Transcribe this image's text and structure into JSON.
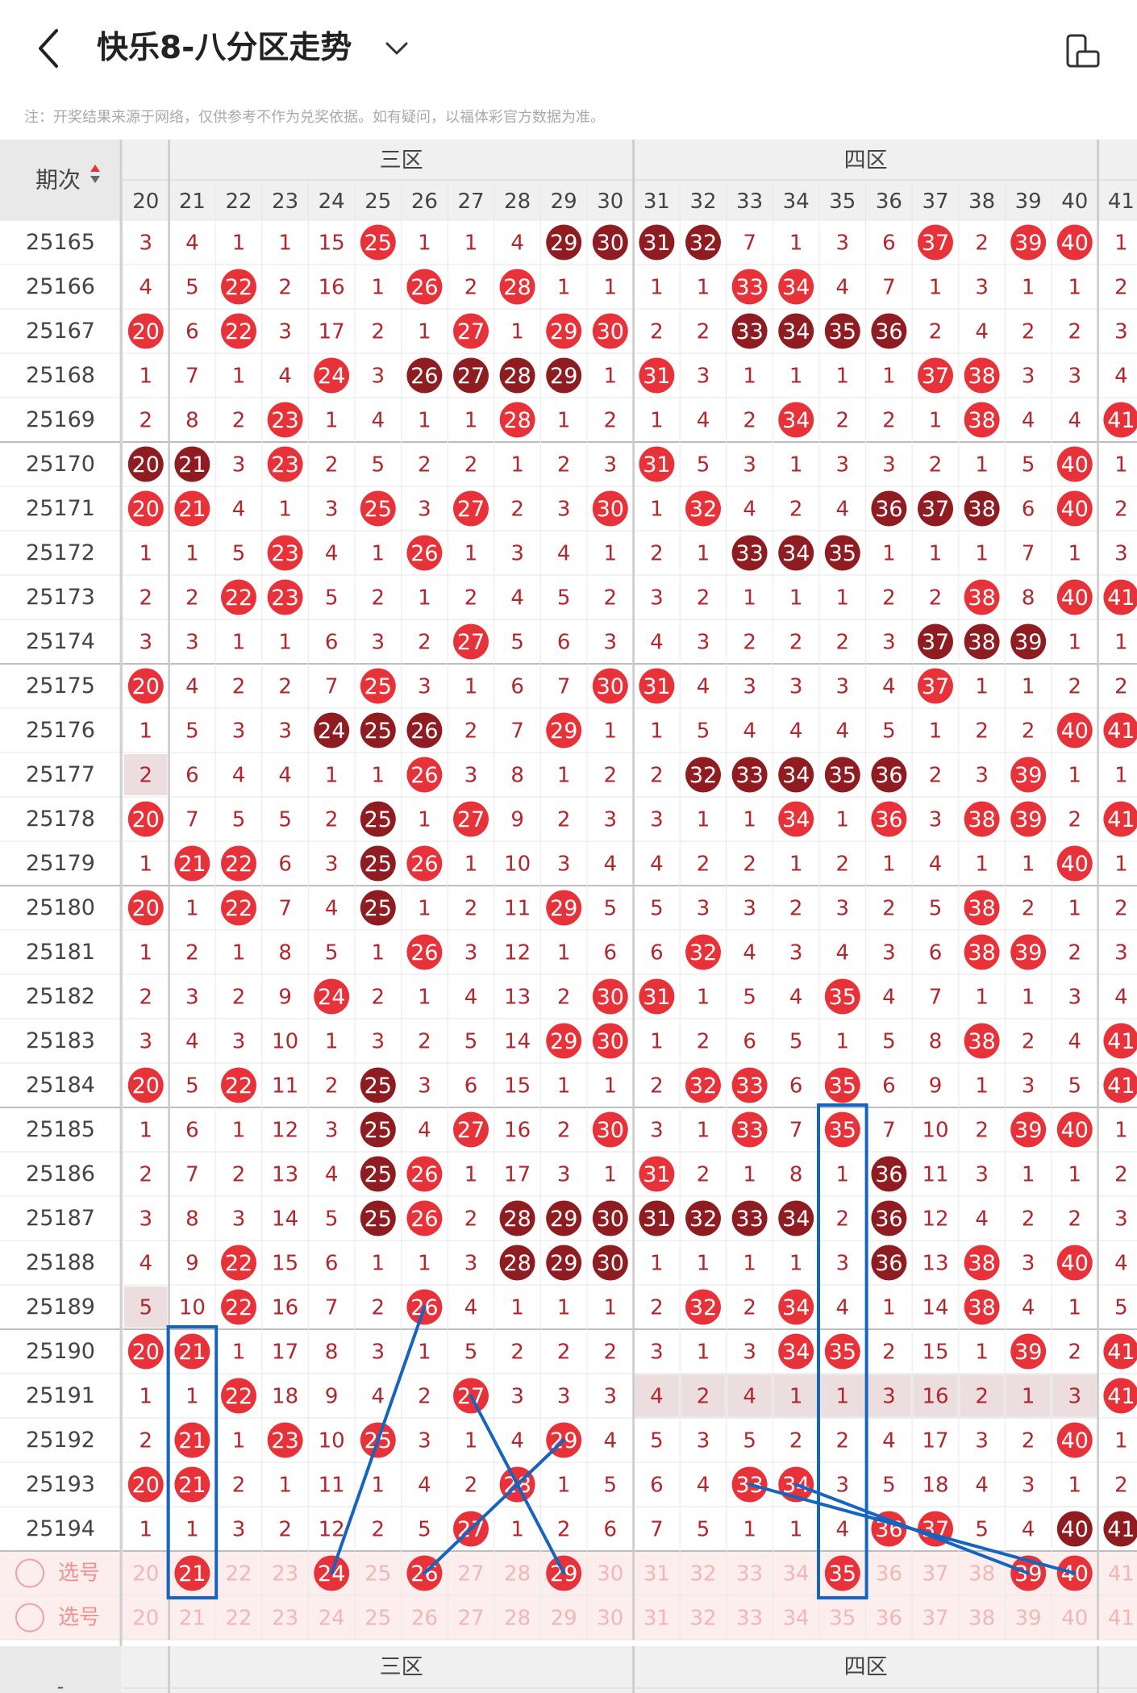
{
  "header": {
    "title": "快乐8-八分区走势",
    "note": "注：开奖结果来源于网络，仅供参考不作为兑奖依据。如有疑问，以福体彩官方数据为准。"
  },
  "table": {
    "period_label": "期次",
    "zones": [
      "三区",
      "四区"
    ],
    "columns": [
      20,
      21,
      22,
      23,
      24,
      25,
      26,
      27,
      28,
      29,
      30,
      31,
      32,
      33,
      34,
      35,
      36,
      37,
      38,
      39,
      40,
      41
    ],
    "select_label": "选号",
    "footer_zones": [
      "三区",
      "四区"
    ],
    "footer_period_label": "-",
    "rows": [
      {
        "period": "25165",
        "cells": [
          3,
          4,
          1,
          1,
          15,
          "R25",
          1,
          1,
          4,
          "D29",
          "D30",
          "D31",
          "D32",
          7,
          1,
          3,
          6,
          "R37",
          2,
          "R39",
          "R40",
          1
        ]
      },
      {
        "period": "25166",
        "cells": [
          4,
          5,
          "R22",
          2,
          16,
          1,
          "R26",
          2,
          "R28",
          1,
          1,
          1,
          1,
          "R33",
          "R34",
          4,
          7,
          1,
          3,
          1,
          1,
          2
        ]
      },
      {
        "period": "25167",
        "cells": [
          "R20",
          6,
          "R22",
          3,
          17,
          2,
          1,
          "R27",
          1,
          "R29",
          "R30",
          2,
          2,
          "D33",
          "D34",
          "D35",
          "D36",
          2,
          4,
          2,
          2,
          3
        ]
      },
      {
        "period": "25168",
        "cells": [
          1,
          7,
          1,
          4,
          "R24",
          3,
          "D26",
          "D27",
          "D28",
          "D29",
          1,
          "R31",
          3,
          1,
          1,
          1,
          1,
          "R37",
          "R38",
          3,
          3,
          4
        ]
      },
      {
        "period": "25169",
        "cells": [
          2,
          8,
          2,
          "R23",
          1,
          4,
          1,
          1,
          "R28",
          1,
          2,
          1,
          4,
          2,
          "R34",
          2,
          2,
          1,
          "R38",
          4,
          4,
          "R41"
        ]
      },
      {
        "period": "25170",
        "cells": [
          "D20",
          "D21",
          3,
          "R23",
          2,
          5,
          2,
          2,
          1,
          2,
          3,
          "R31",
          5,
          3,
          1,
          3,
          3,
          2,
          1,
          5,
          "R40",
          1
        ]
      },
      {
        "period": "25171",
        "cells": [
          "R20",
          "R21",
          4,
          1,
          3,
          "R25",
          3,
          "R27",
          2,
          3,
          "R30",
          1,
          "R32",
          4,
          2,
          4,
          "D36",
          "D37",
          "D38",
          6,
          "R40",
          2
        ]
      },
      {
        "period": "25172",
        "cells": [
          1,
          1,
          5,
          "R23",
          4,
          1,
          "R26",
          1,
          3,
          4,
          1,
          2,
          1,
          "D33",
          "D34",
          "D35",
          1,
          1,
          1,
          7,
          1,
          3
        ]
      },
      {
        "period": "25173",
        "cells": [
          2,
          2,
          "R22",
          "R23",
          5,
          2,
          1,
          2,
          4,
          5,
          2,
          3,
          2,
          1,
          1,
          1,
          2,
          2,
          "R38",
          8,
          "R40",
          "R41"
        ]
      },
      {
        "period": "25174",
        "cells": [
          3,
          3,
          1,
          1,
          6,
          3,
          2,
          "R27",
          5,
          6,
          3,
          4,
          3,
          2,
          2,
          2,
          3,
          "D37",
          "D38",
          "D39",
          1,
          1
        ]
      },
      {
        "period": "25175",
        "cells": [
          "R20",
          4,
          2,
          2,
          7,
          "R25",
          3,
          1,
          6,
          7,
          "R30",
          "R31",
          4,
          3,
          3,
          3,
          4,
          "R37",
          1,
          1,
          2,
          2
        ]
      },
      {
        "period": "25176",
        "cells": [
          1,
          5,
          3,
          3,
          "D24",
          "D25",
          "D26",
          2,
          7,
          "R29",
          1,
          1,
          5,
          4,
          4,
          4,
          5,
          1,
          2,
          2,
          "R40",
          "R41"
        ]
      },
      {
        "period": "25177",
        "cells": [
          "g2",
          6,
          4,
          4,
          1,
          1,
          "R26",
          3,
          8,
          1,
          2,
          2,
          "D32",
          "D33",
          "D34",
          "D35",
          "D36",
          2,
          3,
          "R39",
          1,
          1
        ]
      },
      {
        "period": "25178",
        "cells": [
          "R20",
          7,
          5,
          5,
          2,
          "D25",
          1,
          "R27",
          9,
          2,
          3,
          3,
          1,
          1,
          "R34",
          1,
          "R36",
          3,
          "R38",
          "R39",
          2,
          "R41"
        ]
      },
      {
        "period": "25179",
        "cells": [
          1,
          "R21",
          "R22",
          6,
          3,
          "D25",
          "R26",
          1,
          10,
          3,
          4,
          4,
          2,
          2,
          1,
          2,
          1,
          4,
          1,
          1,
          "R40",
          1
        ]
      },
      {
        "period": "25180",
        "cells": [
          "R20",
          1,
          "R22",
          7,
          4,
          "D25",
          1,
          2,
          11,
          "R29",
          5,
          5,
          3,
          3,
          2,
          3,
          2,
          5,
          "R38",
          2,
          1,
          2
        ]
      },
      {
        "period": "25181",
        "cells": [
          1,
          2,
          1,
          8,
          5,
          1,
          "R26",
          3,
          12,
          1,
          6,
          6,
          "R32",
          4,
          3,
          4,
          3,
          6,
          "R38",
          "R39",
          2,
          3
        ]
      },
      {
        "period": "25182",
        "cells": [
          2,
          3,
          2,
          9,
          "R24",
          2,
          1,
          4,
          13,
          2,
          "R30",
          "R31",
          1,
          5,
          4,
          "R35",
          4,
          7,
          1,
          1,
          3,
          4
        ]
      },
      {
        "period": "25183",
        "cells": [
          3,
          4,
          3,
          10,
          1,
          3,
          2,
          5,
          14,
          "R29",
          "R30",
          1,
          2,
          6,
          5,
          1,
          5,
          8,
          "R38",
          2,
          4,
          "R41"
        ]
      },
      {
        "period": "25184",
        "cells": [
          "R20",
          5,
          "R22",
          11,
          2,
          "D25",
          3,
          6,
          15,
          1,
          1,
          2,
          "R32",
          "R33",
          6,
          "R35",
          6,
          9,
          1,
          3,
          5,
          "R41"
        ]
      },
      {
        "period": "25185",
        "cells": [
          1,
          6,
          1,
          12,
          3,
          "D25",
          4,
          "R27",
          16,
          2,
          "R30",
          3,
          1,
          "R33",
          7,
          "R35",
          7,
          10,
          2,
          "R39",
          "R40",
          1
        ]
      },
      {
        "period": "25186",
        "cells": [
          2,
          7,
          2,
          13,
          4,
          "D25",
          "R26",
          1,
          17,
          3,
          1,
          "R31",
          2,
          1,
          8,
          1,
          "D36",
          11,
          3,
          1,
          1,
          2
        ]
      },
      {
        "period": "25187",
        "cells": [
          3,
          8,
          3,
          14,
          5,
          "D25",
          "R26",
          2,
          "D28",
          "D29",
          "D30",
          "D31",
          "D32",
          "D33",
          "D34",
          2,
          "D36",
          12,
          4,
          2,
          2,
          3
        ]
      },
      {
        "period": "25188",
        "cells": [
          4,
          9,
          "R22",
          15,
          6,
          1,
          1,
          3,
          "D28",
          "D29",
          "D30",
          1,
          1,
          1,
          1,
          3,
          "D36",
          13,
          "R38",
          3,
          "R40",
          4
        ]
      },
      {
        "period": "25189",
        "cells": [
          "g5",
          10,
          "R22",
          16,
          7,
          2,
          "R26",
          4,
          1,
          1,
          1,
          2,
          "R32",
          2,
          "R34",
          4,
          1,
          14,
          "R38",
          4,
          1,
          5
        ]
      },
      {
        "period": "25190",
        "cells": [
          "R20",
          "R21",
          1,
          17,
          8,
          3,
          1,
          5,
          2,
          2,
          2,
          3,
          1,
          3,
          "R34",
          "R35",
          2,
          15,
          1,
          "R39",
          2,
          "R41"
        ]
      },
      {
        "period": "25191",
        "cells": [
          1,
          1,
          "R22",
          18,
          9,
          4,
          2,
          "R27",
          3,
          3,
          3,
          "g4",
          "g2",
          "g4",
          "g1",
          "g1",
          "g3",
          "g16",
          "g2",
          "g1",
          "g3",
          "R41"
        ]
      },
      {
        "period": "25192",
        "cells": [
          2,
          "R21",
          1,
          "R23",
          10,
          "R25",
          3,
          1,
          4,
          "R29",
          4,
          5,
          3,
          5,
          2,
          2,
          4,
          17,
          3,
          2,
          "R40",
          1
        ]
      },
      {
        "period": "25193",
        "cells": [
          "R20",
          "R21",
          2,
          1,
          11,
          1,
          4,
          2,
          "R28",
          1,
          5,
          6,
          4,
          "R33",
          "R34",
          3,
          5,
          18,
          4,
          3,
          1,
          2
        ]
      },
      {
        "period": "25194",
        "cells": [
          1,
          1,
          3,
          2,
          12,
          2,
          5,
          "R27",
          1,
          2,
          6,
          7,
          5,
          1,
          1,
          4,
          "R36",
          "R37",
          5,
          4,
          "D40",
          "D41"
        ]
      }
    ],
    "select_rows": [
      {
        "cells": [
          20,
          "R21",
          22,
          23,
          "R24",
          25,
          "R26",
          27,
          28,
          "R29",
          30,
          31,
          32,
          33,
          34,
          "R35",
          36,
          37,
          38,
          "R39",
          "R40",
          41
        ]
      },
      {
        "cells": [
          20,
          21,
          22,
          23,
          24,
          25,
          26,
          27,
          28,
          29,
          30,
          31,
          32,
          33,
          34,
          35,
          36,
          37,
          38,
          39,
          40,
          41
        ]
      }
    ]
  },
  "colors": {
    "red_ball": "#e8323a",
    "dark_ball": "#8f1c21",
    "number_text": "#b3262c",
    "header_bg": "#f0f0f0",
    "select_bg": "#fdeeee",
    "annotation": "#1565c0"
  }
}
